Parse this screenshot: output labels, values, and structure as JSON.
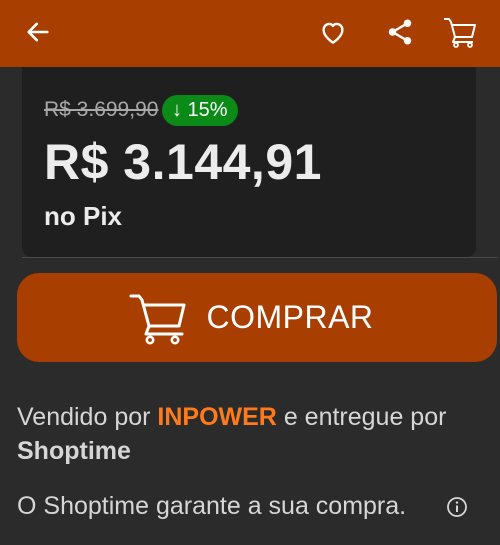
{
  "header": {
    "back_icon": "arrow-left-icon",
    "favorite_icon": "heart-icon",
    "share_icon": "share-icon",
    "cart_icon": "cart-icon",
    "background": "#a83e00"
  },
  "price": {
    "old_price": "R$ 3.699,90",
    "discount": "↓ 15%",
    "current_price": "R$ 3.144,91",
    "payment_method": "no Pix",
    "discount_color": "#0c8a17"
  },
  "buy_button": {
    "label": "COMPRAR",
    "icon": "cart-icon",
    "background": "#a83e00"
  },
  "seller_info": {
    "sold_by_prefix": "Vendido por",
    "seller_name": "INPOWER",
    "delivered_by_prefix": "e entregue por",
    "deliverer_name": "Shoptime",
    "seller_color": "#ff7a1a"
  },
  "guarantee": {
    "text": "O Shoptime garante a sua compra.",
    "icon": "info-icon"
  }
}
